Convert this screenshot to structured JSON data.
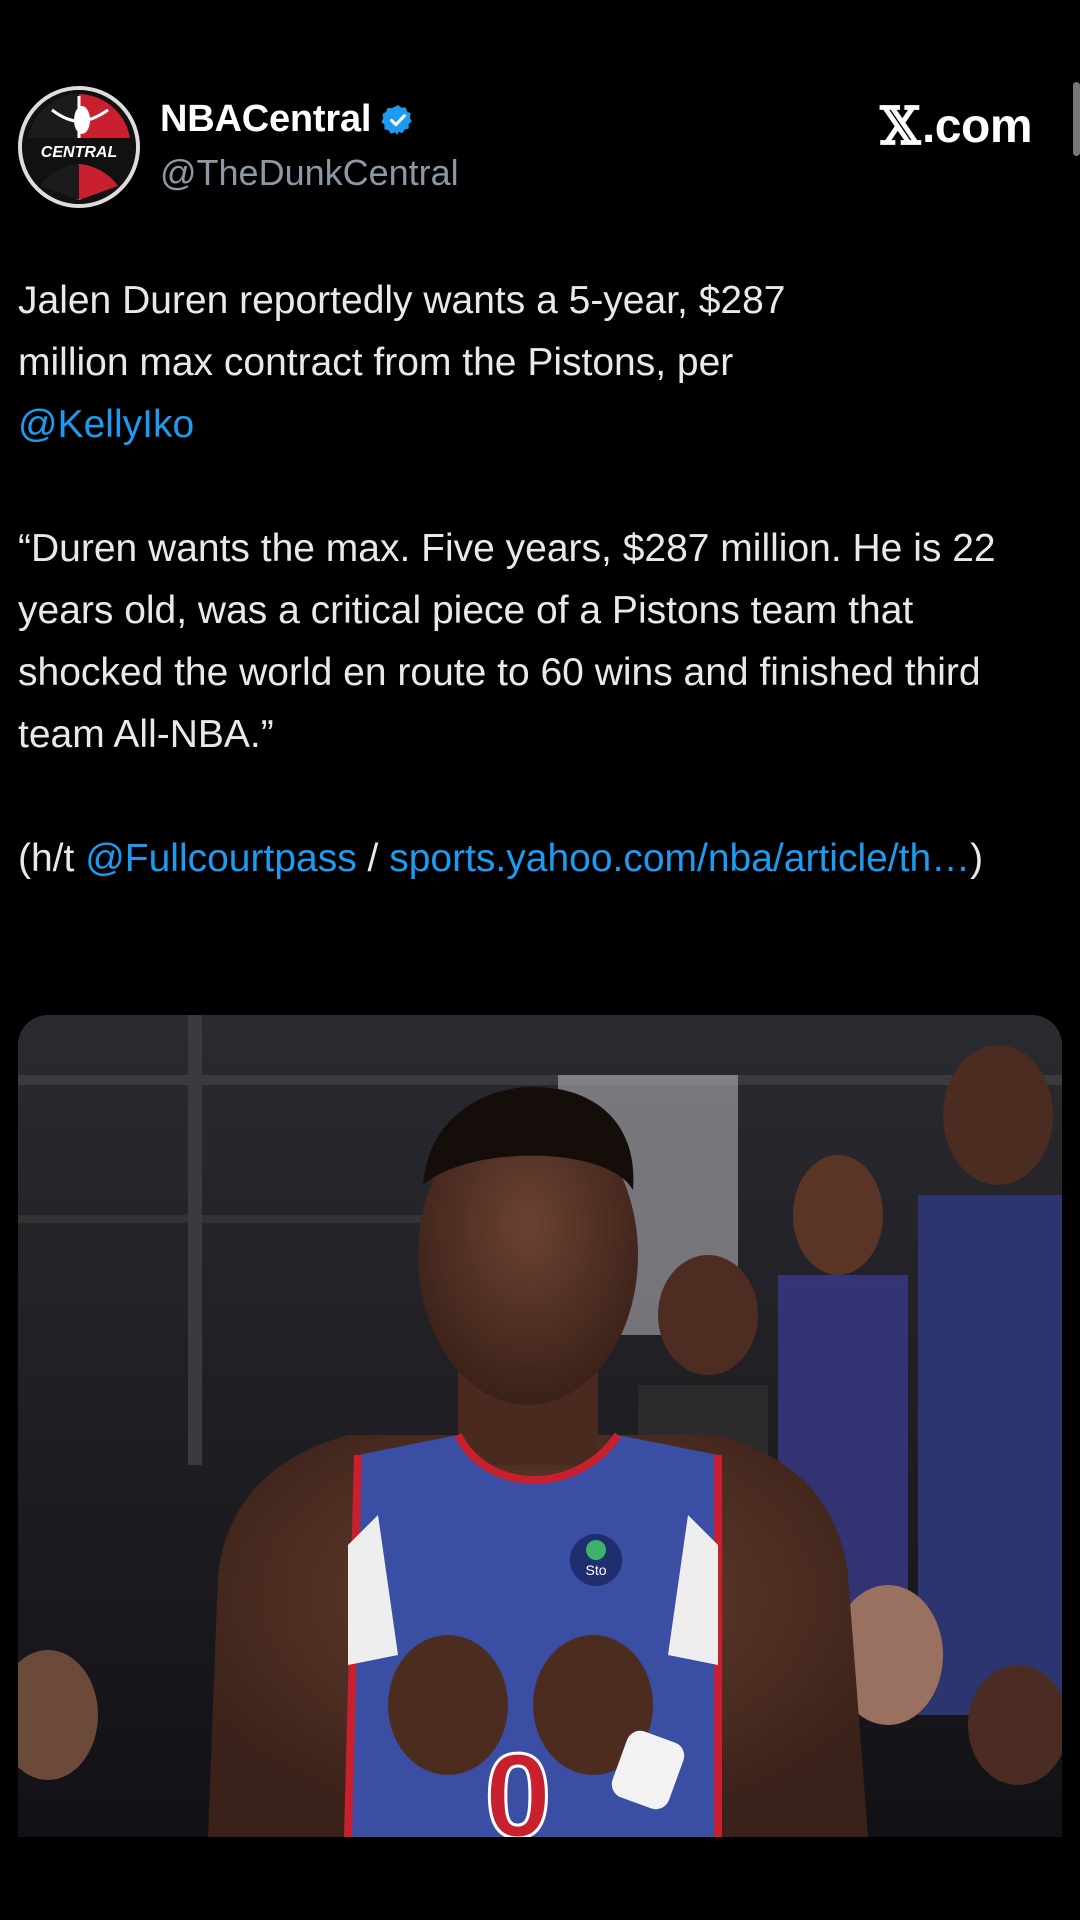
{
  "header": {
    "display_name": "NBACentral",
    "handle": "@TheDunkCentral",
    "verified_icon": "verified-badge-icon",
    "avatar_text": "CENTRAL",
    "brand": "X.com",
    "brand_x_glyph": "𝕏",
    "brand_suffix": ".com"
  },
  "tweet": {
    "line1_a": "Jalen Duren reportedly wants a 5-year, $287",
    "line1_b": "million max contract from the Pistons, per",
    "mention_kelly": "@KellyIko",
    "quote": "“Duren wants the max. Five years, $287 million. He is 22 years old, was a critical piece of a Pistons team that shocked the world en route to 60 wins and finished third team All-NBA.”",
    "ht_prefix": "(h/t ",
    "mention_full": "@Fullcourtpass",
    "ht_sep": " / ",
    "link_text": "sports.yahoo.com/nba/article/th…",
    "ht_suffix": ")"
  },
  "media": {
    "jersey_number": "0",
    "jersey_sponsor": "Sto"
  },
  "colors": {
    "background": "#000000",
    "link": "#1d9bf0",
    "secondary_text": "#8b98a5",
    "verified": "#1d9bf0",
    "jersey_blue": "#3a4fa3",
    "jersey_red": "#c8202f"
  }
}
